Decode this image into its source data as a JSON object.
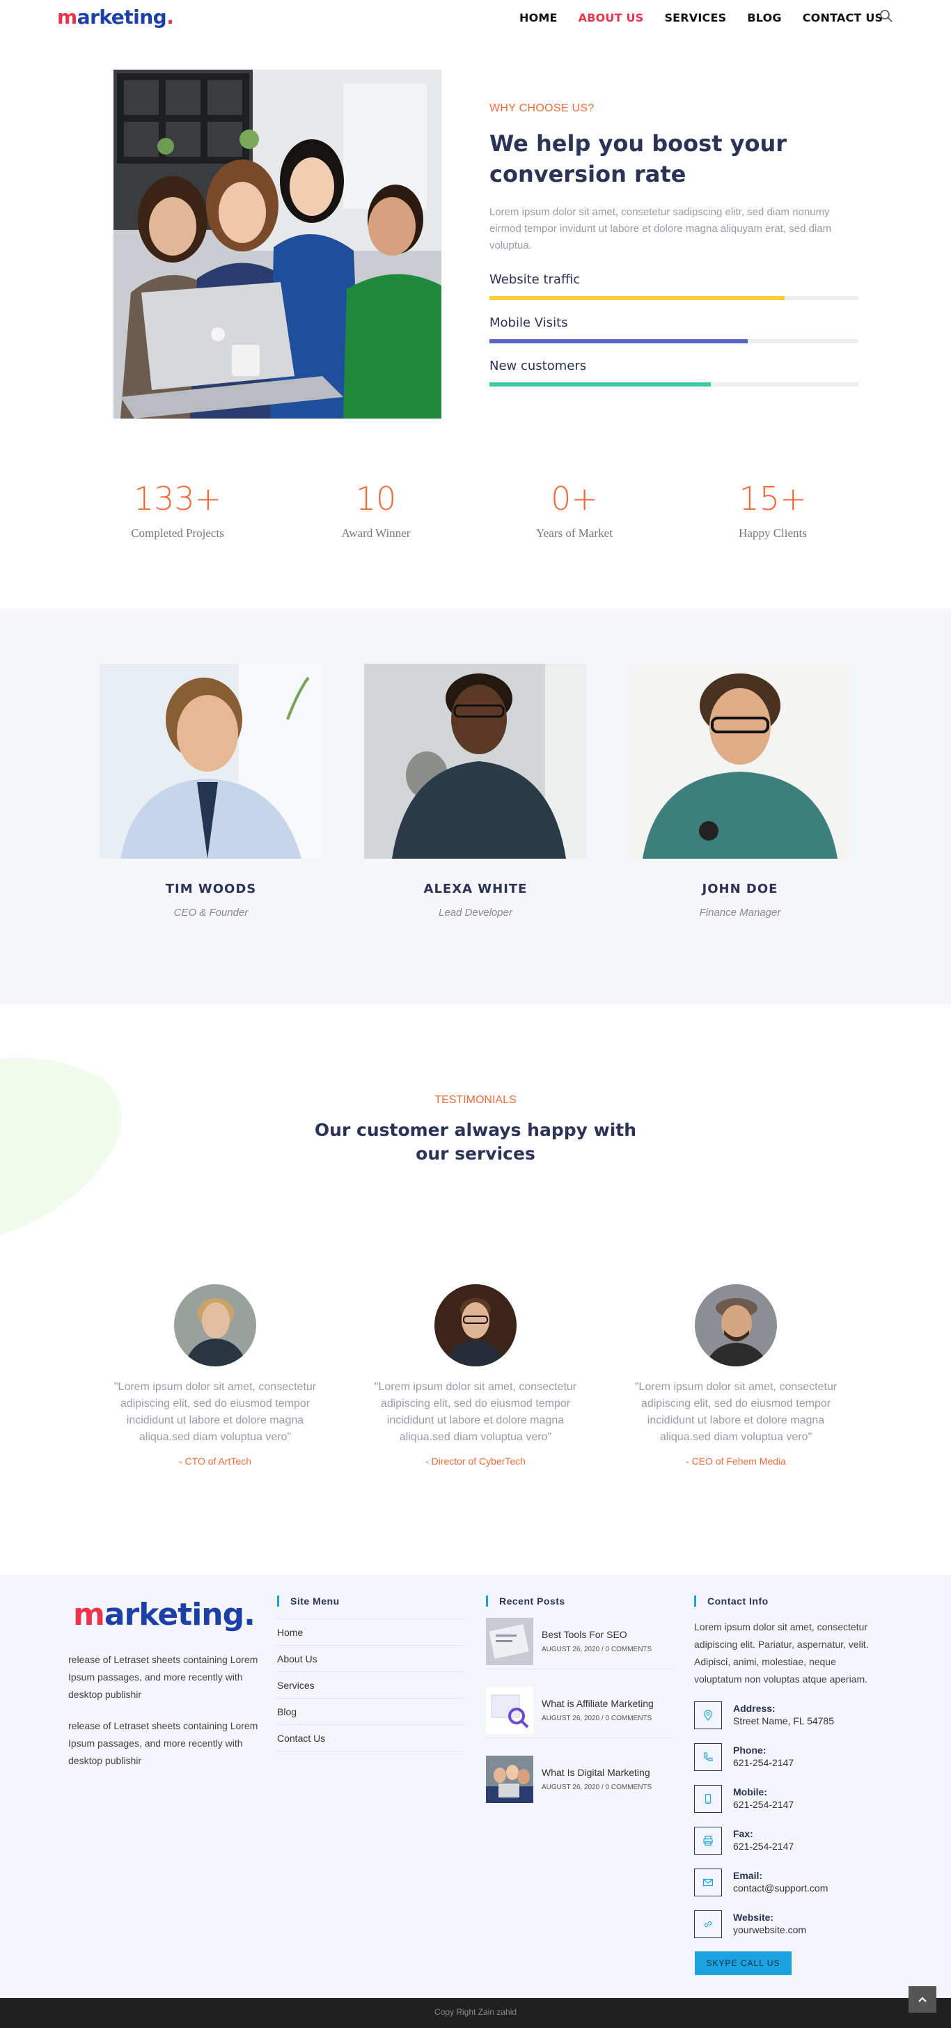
{
  "header": {
    "logo_first": "m",
    "logo_rest": "arketing",
    "logo_dot": ".",
    "nav": [
      "HOME",
      "ABOUT US",
      "SERVICES",
      "BLOG",
      "CONTACT US"
    ],
    "active_nav": "ABOUT US",
    "search_icon": "search-icon"
  },
  "about": {
    "eyebrow": "WHY CHOOSE US?",
    "title": "We help you boost your conversion rate",
    "text": "Lorem ipsum dolor sit amet, consetetur sadipscing elitr, sed diam nonumy eirmod tempor invidunt ut labore et dolore magna aliquyam erat, sed diam voluptua.",
    "skills": [
      {
        "label": "Website traffic",
        "level": 0.8,
        "color": "#ffcc33"
      },
      {
        "label": "Mobile Visits",
        "level": 0.7,
        "color": "#5866c9"
      },
      {
        "label": "New customers",
        "level": 0.6,
        "color": "#3dcaa0"
      }
    ]
  },
  "counters": [
    {
      "value": "133+",
      "label": "Completed Projects"
    },
    {
      "value": "10",
      "label": "Award Winner"
    },
    {
      "value": "0+",
      "label": "Years of Market"
    },
    {
      "value": "15+",
      "label": "Happy Clients"
    }
  ],
  "team": [
    {
      "name": "TIM WOODS",
      "role": "CEO & Founder"
    },
    {
      "name": "ALEXA WHITE",
      "role": "Lead Developer"
    },
    {
      "name": "JOHN DOE",
      "role": "Finance Manager"
    }
  ],
  "testimonials": {
    "eyebrow": "TESTIMONIALS",
    "title": "Our customer always happy with our services",
    "items": [
      {
        "quote": "\"Lorem ipsum dolor sit amet, consectetur adipiscing elit, sed do eiusmod tempor incididunt ut labore et dolore magna aliqua.sed diam voluptua vero\"",
        "author": "- CTO of ArtTech"
      },
      {
        "quote": "\"Lorem ipsum dolor sit amet, consectetur adipiscing elit, sed do eiusmod tempor incididunt ut labore et dolore magna aliqua.sed diam voluptua vero\"",
        "author": "- Director of CyberTech"
      },
      {
        "quote": "\"Lorem ipsum dolor sit amet, consectetur adipiscing elit, sed do eiusmod tempor incididunt ut labore et dolore magna aliqua.sed diam voluptua vero\"",
        "author": "- CEO of Fehem Media"
      }
    ]
  },
  "footer": {
    "logo_first": "m",
    "logo_rest": "arketing.",
    "about_1": "release of Letraset sheets containing Lorem Ipsum passages, and more recently with desktop publishir",
    "about_2": "release of Letraset sheets containing Lorem Ipsum passages, and more recently with desktop publishir",
    "site_menu_title": "Site Menu",
    "site_menu": [
      "Home",
      "About Us",
      "Services",
      "Blog",
      "Contact Us"
    ],
    "recent_posts_title": "Recent Posts",
    "posts": [
      {
        "title": "Best Tools For SEO",
        "meta": "AUGUST 26, 2020 / 0 COMMENTS"
      },
      {
        "title": "What is Affiliate Marketing",
        "meta": "AUGUST 26, 2020 / 0 COMMENTS"
      },
      {
        "title": "What Is Digital Marketing",
        "meta": "AUGUST 26, 2020 / 0 COMMENTS"
      }
    ],
    "contact_title": "Contact Info",
    "contact_text": "Lorem ipsum dolor sit amet, consectetur adipiscing elit. Pariatur, aspernatur, velit. Adipisci, animi, molestiae, neque voluptatum non voluptas atque aperiam.",
    "contacts": [
      {
        "label": "Address:",
        "value": "Street Name, FL 54785",
        "icon": "map-pin-icon"
      },
      {
        "label": "Phone:",
        "value": "621-254-2147",
        "icon": "phone-icon"
      },
      {
        "label": "Mobile:",
        "value": "621-254-2147",
        "icon": "mobile-icon"
      },
      {
        "label": "Fax:",
        "value": "621-254-2147",
        "icon": "fax-icon"
      },
      {
        "label": "Email:",
        "value": "contact@support.com",
        "icon": "envelope-icon"
      },
      {
        "label": "Website:",
        "value": "yourwebsite.com",
        "icon": "link-icon"
      }
    ],
    "skype_label": "SKYPE CALL US",
    "copyright": "Copy Right Zain zahid"
  },
  "colors": {
    "accent": "#f26a3a",
    "brand": "#1c3fa8",
    "brand_red": "#e8344e",
    "heading": "#2b3356",
    "footer_accent": "#1aa3e0"
  }
}
